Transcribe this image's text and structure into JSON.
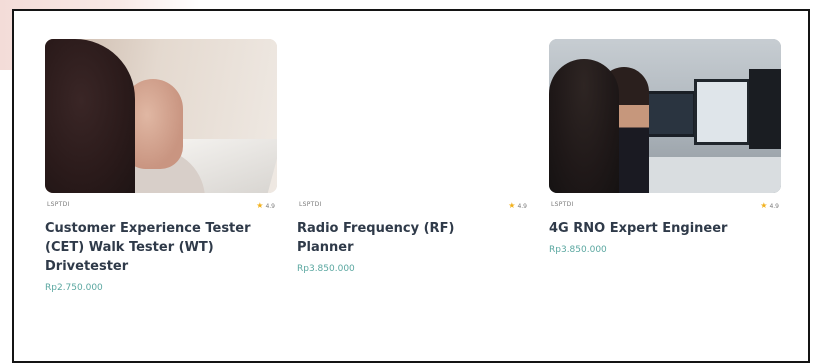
{
  "cards": [
    {
      "provider": "LSPTDI",
      "rating": "4.9",
      "title": "Customer Experience Tester (CET) Walk Tester (WT) Drivetester",
      "price": "Rp2.750.000",
      "image": "office-woman-laptop-photo"
    },
    {
      "provider": "LSPTDI",
      "rating": "4.9",
      "title": "Radio Frequency (RF) Planner",
      "price": "Rp3.850.000",
      "image": "empty-white"
    },
    {
      "provider": "LSPTDI",
      "rating": "4.9",
      "title": "4G RNO Expert Engineer",
      "price": "Rp3.850.000",
      "image": "engineers-at-monitors-photo"
    }
  ],
  "colors": {
    "title": "#2f3a49",
    "price": "#5aa7a0",
    "star": "#f2b11c",
    "frame_border": "#141414"
  }
}
